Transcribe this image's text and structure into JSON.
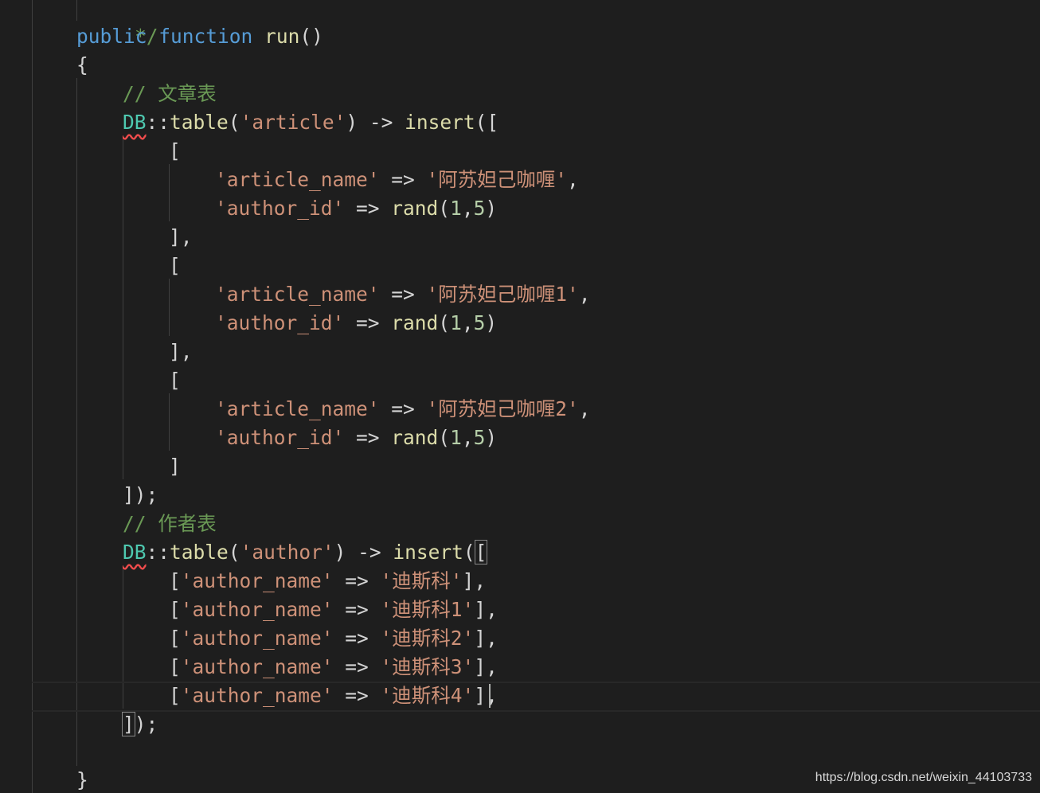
{
  "code": {
    "comment_close": "*/",
    "kw_public": "public",
    "kw_function": "function",
    "method_name": "run",
    "comment_article": "// 文章表",
    "comment_author": "// 作者表",
    "class_db": "DB",
    "method_table": "table",
    "method_insert": "insert",
    "method_rand": "rand",
    "table_article": "'article'",
    "table_author": "'author'",
    "key_article_name": "'article_name'",
    "key_author_id": "'author_id'",
    "key_author_name": "'author_name'",
    "article_values": [
      "'阿苏妲己咖喱'",
      "'阿苏妲己咖喱1'",
      "'阿苏妲己咖喱2'"
    ],
    "author_values": [
      "'迪斯科'",
      "'迪斯科1'",
      "'迪斯科2'",
      "'迪斯科3'",
      "'迪斯科4'"
    ],
    "rand_min": "1",
    "rand_max": "5"
  },
  "watermark": "https://blog.csdn.net/weixin_44103733"
}
